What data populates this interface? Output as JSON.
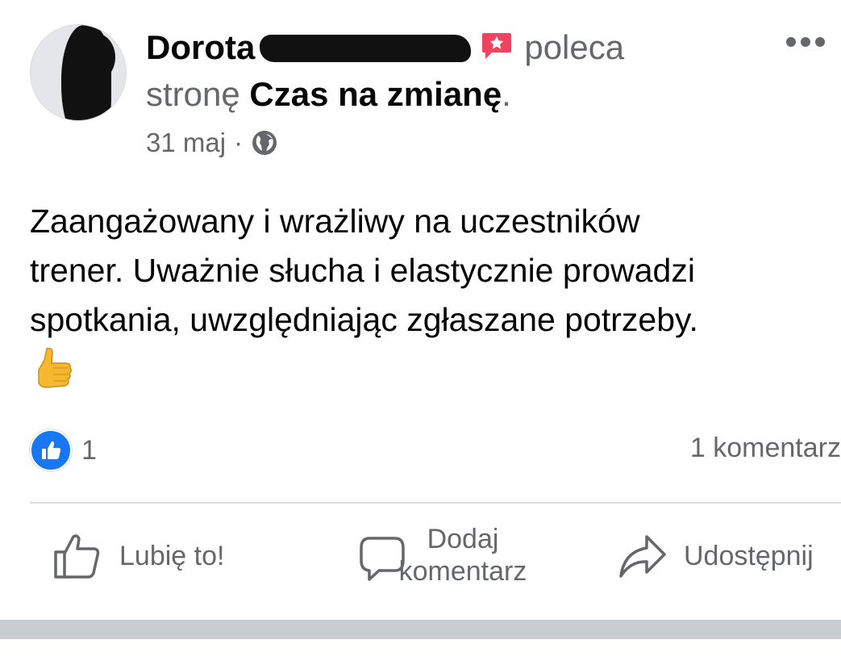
{
  "post": {
    "author_first": "Dorota",
    "verb": "poleca",
    "verb_line2_prefix": "stronę",
    "page_name": "Czas na zmianę",
    "page_suffix": ".",
    "date": "31 maj",
    "separator": "·",
    "audience_icon": "globe-icon",
    "body_lines": [
      "Zaangażowany i wrażliwy na uczestników",
      "trener. Uważnie słucha i elastycznie prowadzi",
      "spotkania, uwzględniając zgłaszane potrzeby."
    ],
    "emoji": "thumbs-up-emoji",
    "reaction_count": "1",
    "comment_count": "1 komentarz"
  },
  "actions": {
    "like": "Lubię to!",
    "comment_line1": "Dodaj",
    "comment_line2": "komentarz",
    "share": "Udostępnij"
  },
  "colors": {
    "accent": "#1877f2",
    "secondary_text": "#65676b",
    "recommend_icon": "#f3425f"
  }
}
